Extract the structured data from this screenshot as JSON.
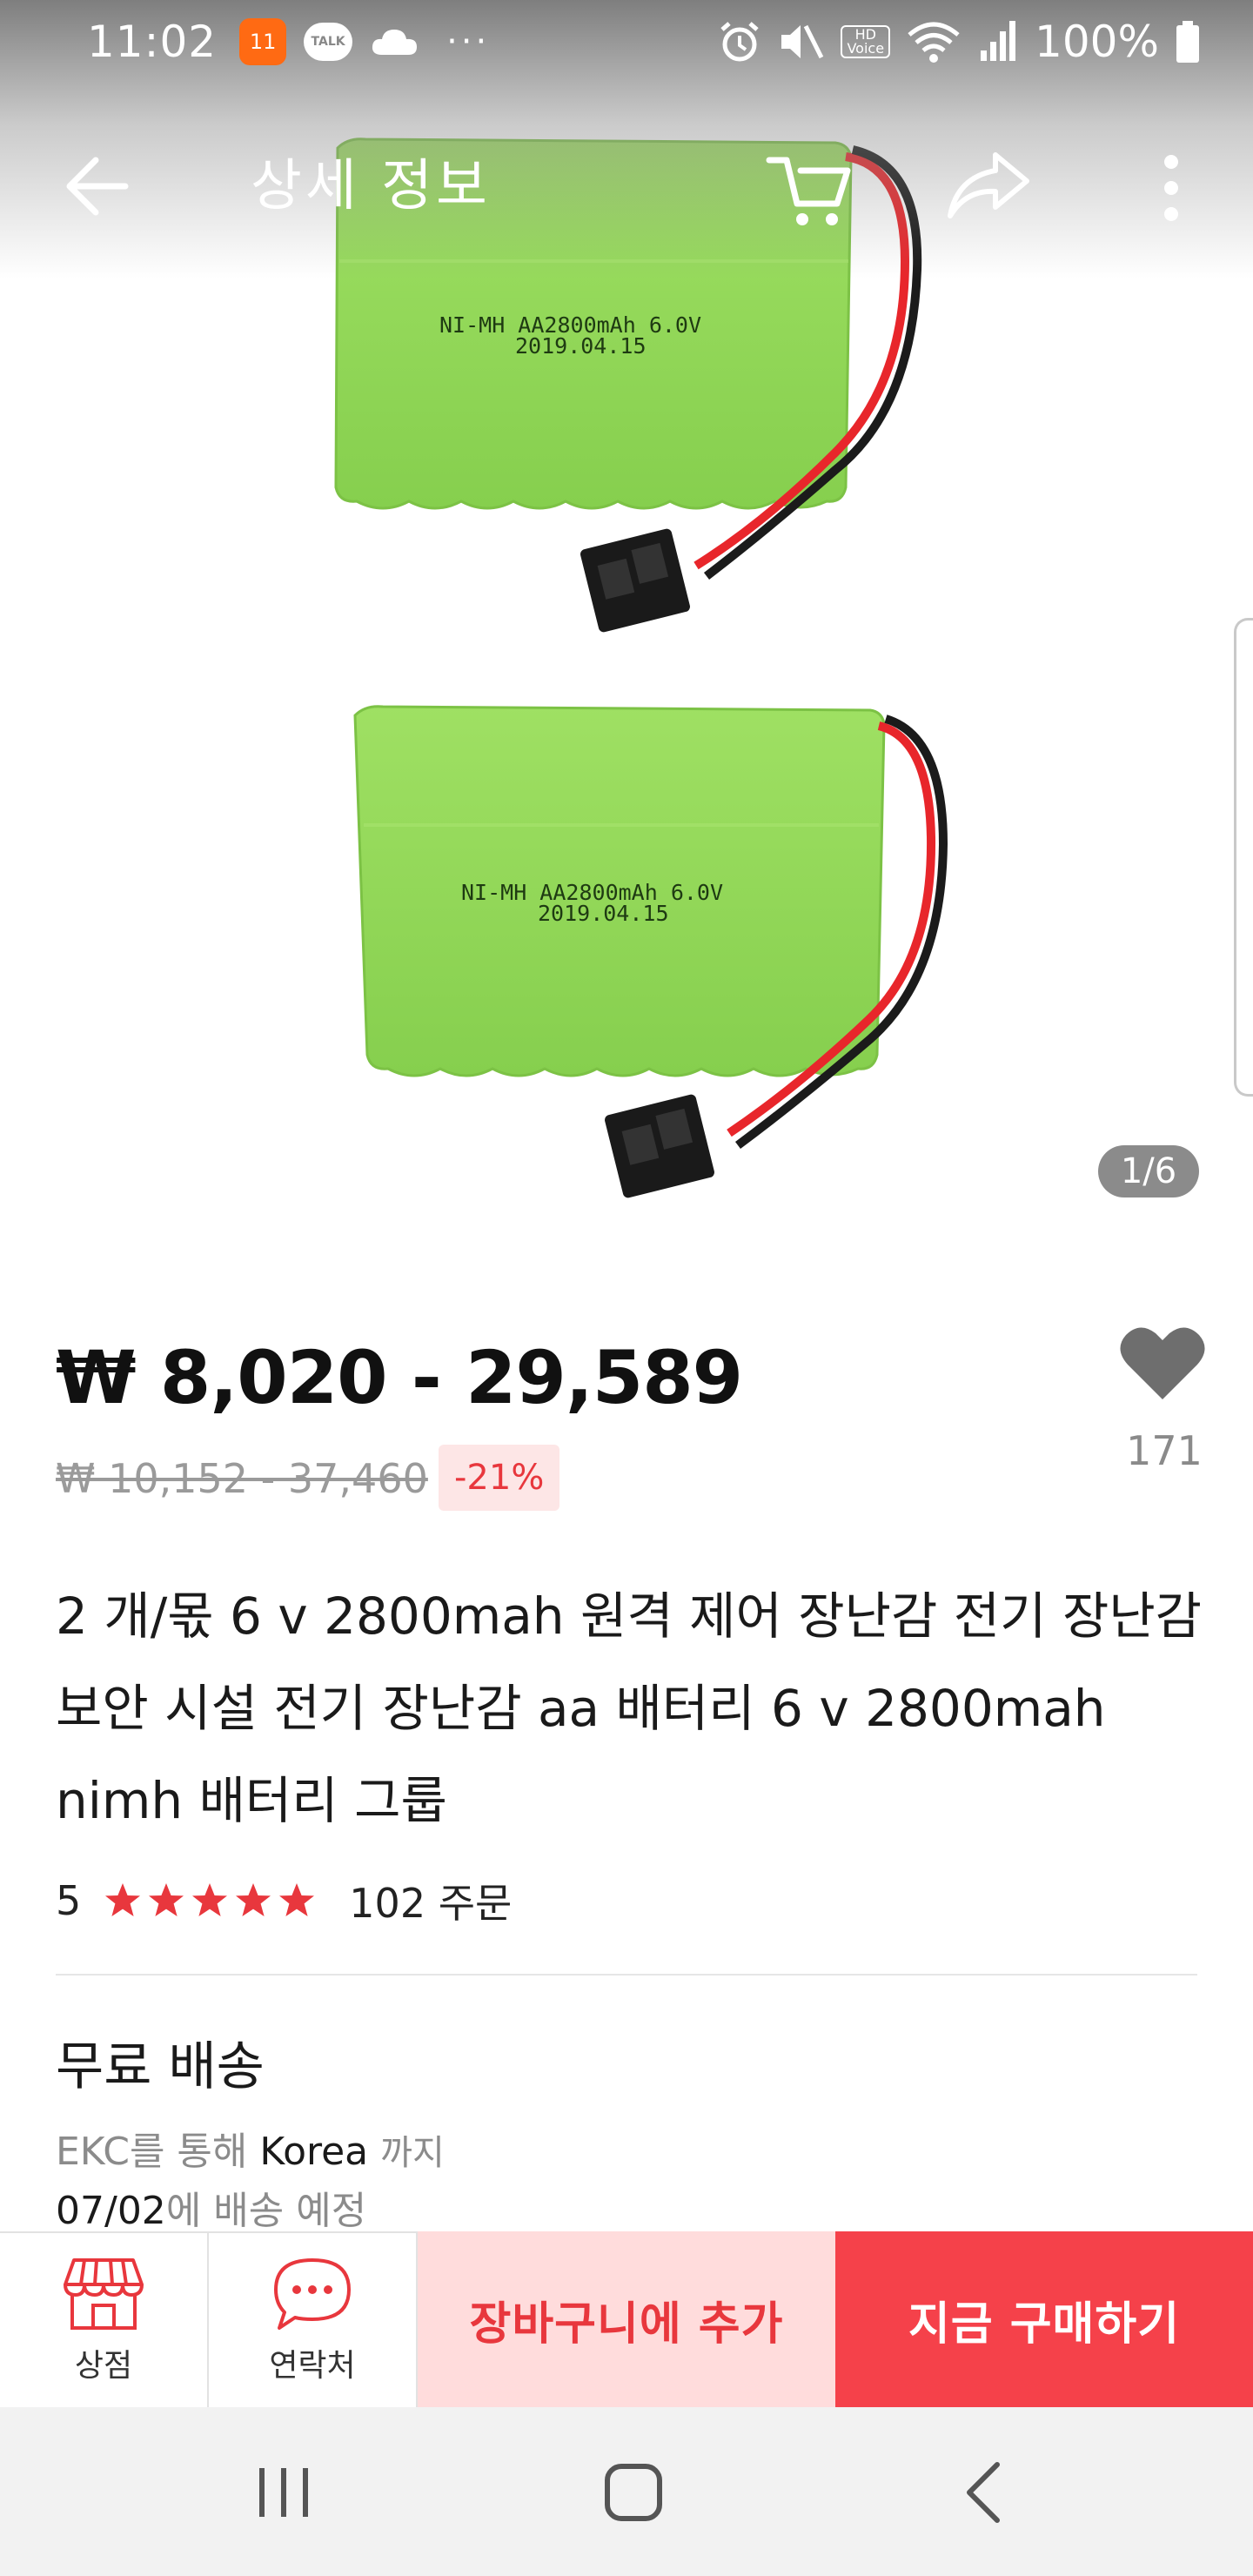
{
  "status_bar": {
    "time": "11:02",
    "app_badge": "11",
    "talk_label": "TALK",
    "hd_label": "HD",
    "voice_label": "Voice",
    "battery": "100%"
  },
  "header": {
    "title": "상세 정보"
  },
  "gallery": {
    "battery_label_line1": "NI-MH AA2800mAh 6.0V",
    "battery_label_line2": "2019.04.15",
    "page_indicator": "1/6"
  },
  "price": {
    "current": "₩ 8,020 - 29,589",
    "original": "₩ 10,152 - 37,460",
    "discount": "-21%"
  },
  "wishlist": {
    "count": "171"
  },
  "product": {
    "title": "2 개/몫 6 v 2800mah 원격 제어 장난감 전기 장난감 보안 시설 전기 장난감 aa 배터리 6 v 2800mah nimh 배터리 그룹",
    "rating": "5",
    "stars": 5,
    "orders": "102 주문"
  },
  "shipping": {
    "title": "무료 배송",
    "carrier_prefix": "EKC를 통해",
    "destination": "Korea",
    "destination_suffix": "까지",
    "date": "07/02",
    "date_suffix": "에 배송 예정"
  },
  "actions": {
    "store_label": "상점",
    "contact_label": "연락처",
    "add_to_cart": "장바구니에 추가",
    "buy_now": "지금 구매하기"
  },
  "colors": {
    "accent": "#f5414a",
    "accent_light": "#ffdcdc",
    "star": "#e8373d",
    "battery_green": "#9fe063"
  }
}
